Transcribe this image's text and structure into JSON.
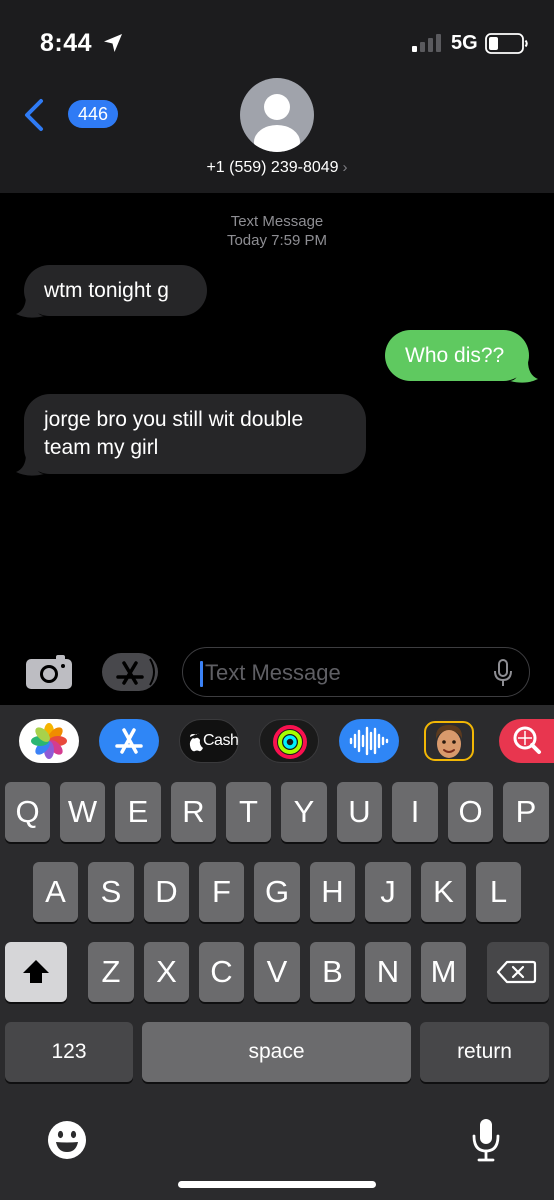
{
  "status_bar": {
    "time": "8:44",
    "network": "5G",
    "location_icon": "location-arrow-icon",
    "signal_icon": "cellular-signal-icon",
    "battery_icon": "battery-low-icon"
  },
  "nav": {
    "back_count": "446",
    "contact_number": "+1 (559) 239-8049",
    "contact_chevron": "›"
  },
  "thread": {
    "service": "Text Message",
    "timestamp": "Today 7:59 PM",
    "messages": [
      {
        "direction": "incoming",
        "text": "wtm tonight g"
      },
      {
        "direction": "outgoing",
        "text": "Who dis??"
      },
      {
        "direction": "incoming",
        "text": "jorge bro you still wit double team my girl"
      }
    ]
  },
  "compose": {
    "placeholder": "Text Message"
  },
  "app_strip": [
    {
      "name": "Photos",
      "icon": "photos-icon"
    },
    {
      "name": "App Store",
      "icon": "app-store-icon"
    },
    {
      "name": "Cash",
      "label": "Cash",
      "icon": "apple-cash-icon"
    },
    {
      "name": "Activity",
      "icon": "activity-rings-icon"
    },
    {
      "name": "Audio",
      "icon": "audio-waveform-icon"
    },
    {
      "name": "Memoji",
      "icon": "memoji-icon"
    },
    {
      "name": "Search",
      "icon": "web-search-icon"
    }
  ],
  "keyboard": {
    "row1": [
      "Q",
      "W",
      "E",
      "R",
      "T",
      "Y",
      "U",
      "I",
      "O",
      "P"
    ],
    "row2": [
      "A",
      "S",
      "D",
      "F",
      "G",
      "H",
      "J",
      "K",
      "L"
    ],
    "row3": [
      "Z",
      "X",
      "C",
      "V",
      "B",
      "N",
      "M"
    ],
    "numbers": "123",
    "space": "space",
    "return": "return"
  },
  "colors": {
    "accent": "#2f7bf5",
    "outgoing_bubble": "#5fc960",
    "incoming_bubble": "#262628"
  }
}
